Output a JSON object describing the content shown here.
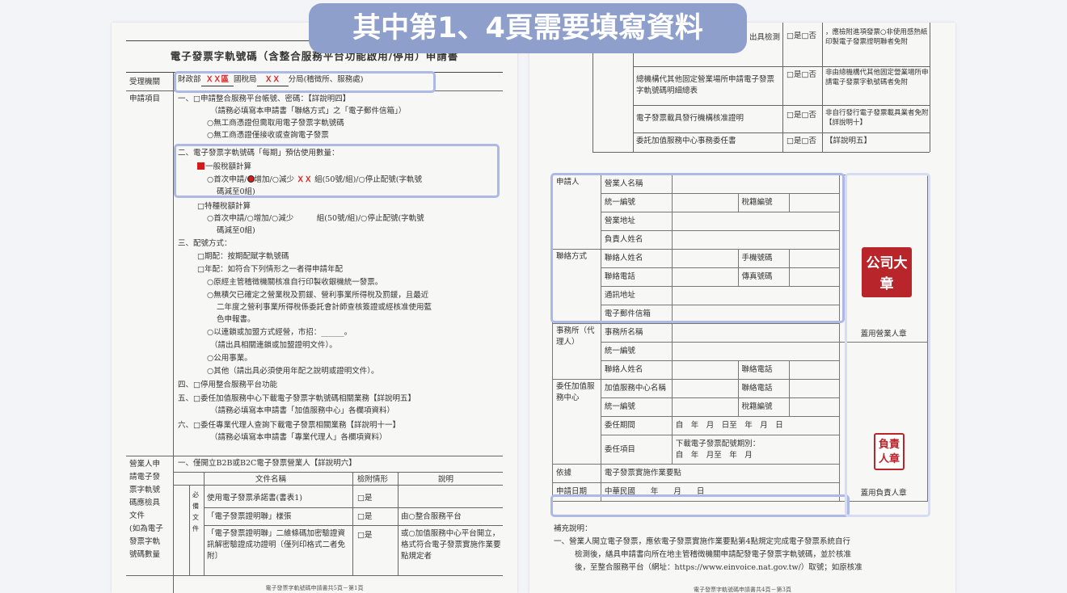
{
  "banner": "其中第1、4頁需要填寫資料",
  "page1": {
    "title": "電子發票字軌號碼（含整合服務平台功能啟用/停用）申請書",
    "agency_label": "受理機關",
    "agency_line": {
      "p1": "財政部",
      "r1": "ＸＸ區",
      "p2": "國稅局",
      "r2": "ＸＸ",
      "p3": "分局(稽徵所、服務處)"
    },
    "apply_label": "申請項目",
    "item1": [
      "一、□申請整合服務平台帳號、密碼：【詳說明四】",
      "（請務必填寫本申請書「聯絡方式」之「電子郵件信箱」）",
      "○無工商憑證但需取用電子發票字軌號碼",
      "○無工商憑證僅接收或查詢電子發票"
    ],
    "item2_title": "二、電子發票字軌號碼「每期」預估使用數量：",
    "item2_general": "一般稅額計算",
    "item2_opts": {
      "a": "○首次申請/",
      "b": "增加/○減少",
      "c": "ＸＸ",
      "d": "組(50號/組)/○停止配號(字軌號",
      "e": "碼減至0組)"
    },
    "item2_special": "□特種稅額計算",
    "item2_special_opts": [
      "○首次申請/○增加/○減少　　　組(50號/組)/○停止配號(字軌號",
      "碼減至0組)"
    ],
    "item3": [
      "三、配號方式：",
      "□期配：按期配賦字軌號碼",
      "□年配：如符合下列情形之一者得申請年配",
      "○原經主管稽徵機關核准自行印製收銀機統一發票。",
      "○無積欠已確定之營業稅及罰鍰、營利事業所得稅及罰鍰，且最近",
      "二年度之營利事業所得稅係委託會計師查核簽證或經核准使用藍",
      "色申報書。",
      "○以連鎖或加盟方式經營，市招：______。",
      "（請出具相關連鎖或加盟證明文件）。",
      "○公用事業。",
      "○其他（請出具必須使用年配之說明或證明文件）。"
    ],
    "item4": "四、□停用整合服務平台功能",
    "item5": [
      "五、□委任加值服務中心下載電子發票字軌號碼相關業務【詳說明五】",
      "（請務必填寫本申請書「加值服務中心」各欄項資料）"
    ],
    "item6": [
      "六、□委任專業代理人查詢下載電子發票相關業務【詳說明十一】",
      "（請務必填寫本申請書「專業代理人」各欄項資料）"
    ],
    "side2": [
      "營業人申",
      "請電子發",
      "票字軌號",
      "碼應檢具",
      "文件",
      "(如為電子",
      "發票字軌",
      "號碼數量"
    ],
    "b2b": "一、僅開立B2B或B2C電子發票營業人【詳說明六】",
    "col_doc": "文件名稱",
    "col_chk": "檢附情形",
    "col_note": "說明",
    "must": [
      "必",
      "備",
      "文",
      "件"
    ],
    "rows": [
      {
        "doc": "使用電子發票承諾書(書表1)",
        "chk": "□是",
        "note": ""
      },
      {
        "doc": "「電子發票證明聯」樣張",
        "chk": "□是",
        "note": "由○整合服務平台"
      },
      {
        "doc": "「電子發票證明聯」二維條碼加密驗證資訊解密驗證成功證明〔僅列印格式二者免附〕",
        "chk": "□是",
        "note": "或○加值服務中心平台開立，格式符合電子發票實施作業要點規定者"
      }
    ],
    "footer": "電子發票字軌號碼申請書共5頁－第1頁"
  },
  "page2": {
    "top_rows": [
      {
        "doc": "出具檢測",
        "chk": "□是□否",
        "note": "，應檢附進項發票○非使用感熱紙印製電子發票證明聯者免附"
      },
      {
        "doc": "總機構代其他固定營業場所申請電子發票字軌號碼明細總表",
        "chk": "□是□否",
        "note": "非由總機構代其他固定營業場所申請電子發票字軌號碼者免附"
      },
      {
        "doc": "電子發票載具發行機構核准證明",
        "chk": "□是□否",
        "note": "非自行發行電子發票載具業者免附【詳說明十】"
      },
      {
        "doc": "委託加值服務中心事務委任書",
        "chk": "□是□否",
        "note": "【詳說明五】"
      }
    ],
    "applicant": "申請人",
    "app_fields": [
      "營業人名稱",
      "統一編號",
      "營業地址",
      "負責人姓名"
    ],
    "tax_no": "稅籍編號",
    "contact": "聯絡方式",
    "contact_fields": [
      "聯絡人姓名",
      "聯絡電話",
      "通訊地址",
      "電子郵件信箱"
    ],
    "mobile": "手機號碼",
    "fax": "傳真號碼",
    "office": "事務所（代理人）",
    "office_fields": [
      "事務所名稱",
      "統一編號",
      "聯絡人姓名"
    ],
    "office_phone": "聯絡電話",
    "vas": "委任加值服務中心",
    "vas_fields": [
      "加值服務中心名稱",
      "統一編號",
      "委任期間",
      "委任項目"
    ],
    "vas_phone": "聯絡電話",
    "vas_tax": "稅籍編號",
    "period": "自　年　月　日至　年　月　日",
    "item": "下載電子發票配號期別：\n自　年　月至　年　月",
    "basis": "依據",
    "basis_val": "電子發票實施作業要點",
    "date_label": "申請日期",
    "date_val": "中華民國　　年　　月　　日",
    "stamp_company": "公司大章",
    "stamp_company_cap": "蓋用營業人章",
    "stamp_owner": "負責人章",
    "stamp_owner_cap": "蓋用負責人章",
    "notes": [
      "補充說明：",
      "一、營業人開立電子發票，應依電子發票實施作業要點第4點規定完成電子發票系統自行",
      "檢測後，繕具申請書向所在地主管稽徵機關申請配發電子發票字軌號碼，並於核准",
      "後，至整合服務平台（網址：https://www.einvoice.nat.gov.tw/）取號；如原核准"
    ],
    "footer": "電子發票字軌號碼申請書共4頁－第3頁"
  }
}
